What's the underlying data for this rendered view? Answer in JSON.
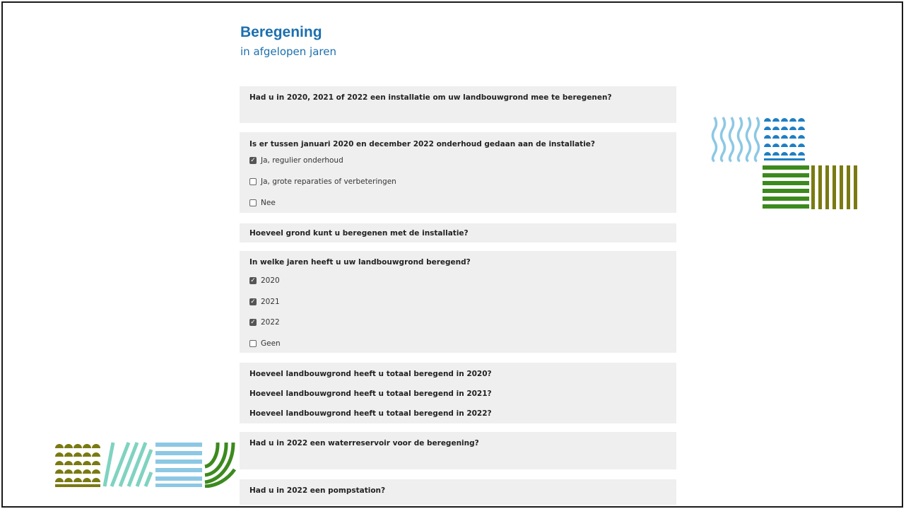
{
  "header": {
    "title": "Beregening",
    "subtitle": "in afgelopen jaren"
  },
  "questions": {
    "q1": "Had u in 2020, 2021 of 2022 een installatie om uw landbouwgrond mee te beregenen?",
    "q2": {
      "label": "Is er tussen januari 2020 en december 2022 onderhoud gedaan aan de installatie?",
      "options": [
        {
          "label": "Ja, regulier onderhoud",
          "checked": true
        },
        {
          "label": "Ja, grote reparaties of verbeteringen",
          "checked": false
        },
        {
          "label": "Nee",
          "checked": false
        }
      ]
    },
    "q3": "Hoeveel grond kunt u beregenen met de installatie?",
    "q4": {
      "label": "In welke jaren heeft u uw landbouwgrond beregend?",
      "options": [
        {
          "label": "2020",
          "checked": true
        },
        {
          "label": "2021",
          "checked": true
        },
        {
          "label": "2022",
          "checked": true
        },
        {
          "label": "Geen",
          "checked": false
        }
      ]
    },
    "q5": [
      "Hoeveel landbouwgrond heeft u totaal beregend in 2020?",
      "Hoeveel landbouwgrond heeft u totaal beregend in 2021?",
      "Hoeveel landbouwgrond heeft u totaal beregend in 2022?"
    ],
    "q6": "Had u in 2022 een waterreservoir voor de beregening?",
    "q7": "Had u in 2022 een pompstation?"
  },
  "colors": {
    "heading": "#1c6fae",
    "panel": "#efefef",
    "deco_lightblue": "#8cc8e4",
    "deco_blue": "#1e7fc3",
    "deco_green": "#3c8a1e",
    "deco_olive": "#7a7a12",
    "deco_mint": "#7fd3c0"
  }
}
